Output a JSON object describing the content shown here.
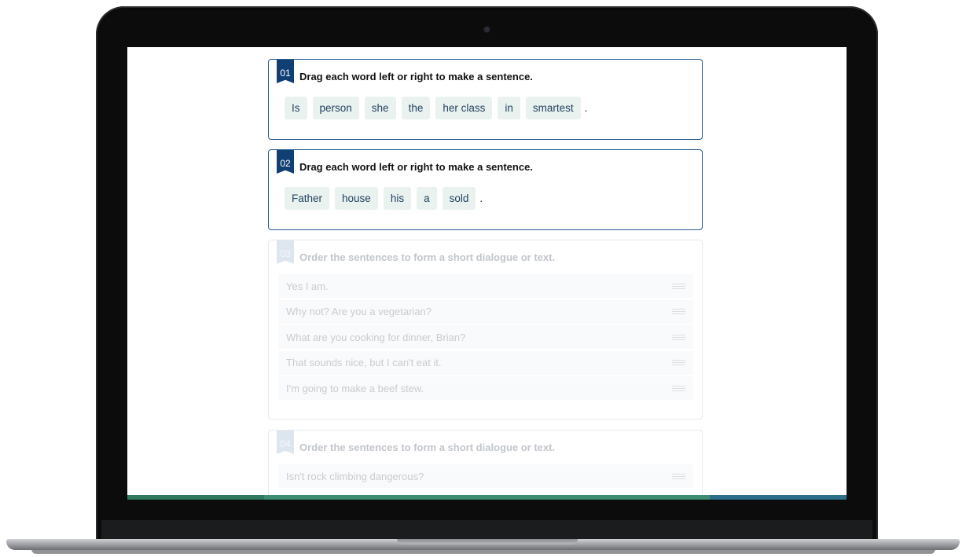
{
  "exercises": [
    {
      "number": "01",
      "instruction": "Drag each word left or right to make a sentence.",
      "words": [
        "Is",
        "person",
        "she",
        "the",
        "her class",
        "in",
        "smartest"
      ],
      "end_punctuation": "."
    },
    {
      "number": "02",
      "instruction": "Drag each word left or right to make a sentence.",
      "words": [
        "Father",
        "house",
        "his",
        "a",
        "sold"
      ],
      "end_punctuation": "."
    },
    {
      "number": "03",
      "instruction": "Order the sentences to form a short dialogue or text.",
      "sentences": [
        "Yes I am.",
        "Why not? Are you a vegetarian?",
        "What are you cooking for dinner, Brian?",
        "That sounds nice, but I can't eat it.",
        "I'm going to make a beef stew."
      ]
    },
    {
      "number": "04",
      "instruction": "Order the sentences to form a short dialogue or text.",
      "sentences": [
        "Isn't rock climbing dangerous?"
      ]
    }
  ],
  "icons": {
    "drag_handle": "drag-handle-icon",
    "camera": "camera-icon"
  },
  "colors": {
    "badge_active": "#0f3f73",
    "card_border_active": "#2a5d8e",
    "word_chip_bg": "#eaf2f0",
    "progress_bar": "#3c8d72"
  }
}
